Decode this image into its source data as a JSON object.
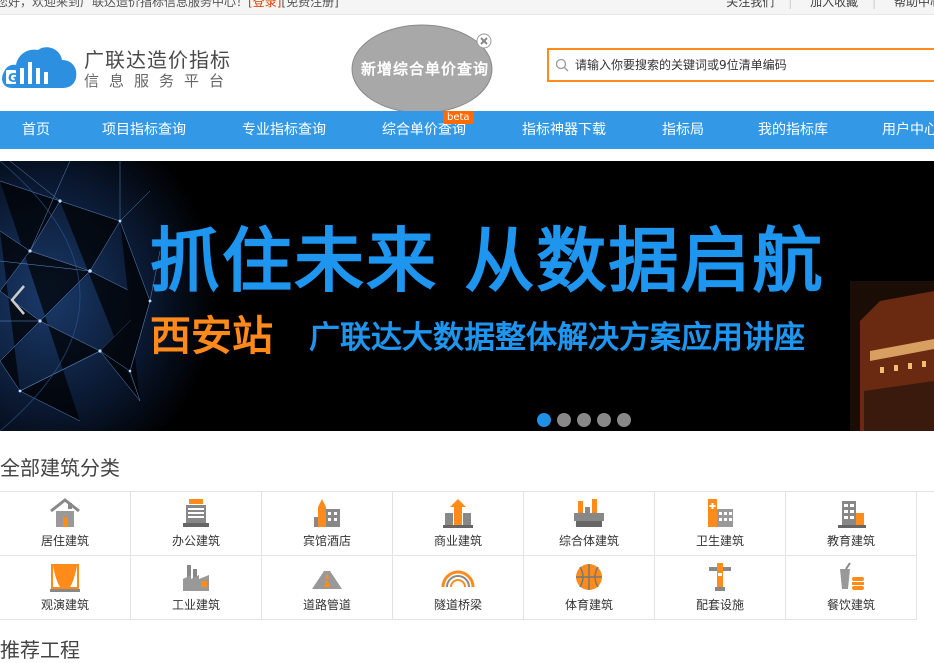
{
  "topbar": {
    "welcome": "您好，欢迎来到广联达造价指标信息服务中心！",
    "login": "[登录]",
    "register": "[免费注册]",
    "links": [
      "关注我们",
      "加入收藏",
      "帮助中心"
    ]
  },
  "header": {
    "brand_title": "广联达造价指标",
    "brand_sub": "信息服务平台",
    "bubble_text": "新增综合单价查询"
  },
  "search": {
    "placeholder": "请输入你要搜索的关键词或9位清单编码"
  },
  "nav": {
    "items": [
      "首页",
      "项目指标查询",
      "专业指标查询",
      "综合单价查询",
      "指标神器下载",
      "指标局",
      "我的指标库",
      "用户中心"
    ],
    "beta": "beta"
  },
  "banner": {
    "title": "抓住未来 从数据启航",
    "city": "西安站",
    "subtitle": "广联达大数据整体解决方案应用讲座",
    "slide_count": 5,
    "active_slide": 1
  },
  "category": {
    "title": "全部建筑分类",
    "items": [
      {
        "label": "居住建筑",
        "icon": "house-icon"
      },
      {
        "label": "办公建筑",
        "icon": "office-building-icon"
      },
      {
        "label": "宾馆酒店",
        "icon": "hotel-icon"
      },
      {
        "label": "商业建筑",
        "icon": "commercial-building-icon"
      },
      {
        "label": "综合体建筑",
        "icon": "complex-building-icon"
      },
      {
        "label": "卫生建筑",
        "icon": "hospital-icon"
      },
      {
        "label": "教育建筑",
        "icon": "school-icon"
      },
      {
        "label": "观演建筑",
        "icon": "theater-icon"
      },
      {
        "label": "工业建筑",
        "icon": "factory-icon"
      },
      {
        "label": "道路管道",
        "icon": "road-icon"
      },
      {
        "label": "隧道桥梁",
        "icon": "bridge-icon"
      },
      {
        "label": "体育建筑",
        "icon": "basketball-icon"
      },
      {
        "label": "配套设施",
        "icon": "facility-icon"
      },
      {
        "label": "餐饮建筑",
        "icon": "restaurant-icon"
      }
    ]
  },
  "recommend": {
    "title": "推荐工程"
  },
  "colors": {
    "nav_blue": "#3399e6",
    "accent_orange": "#ff8c1a",
    "banner_blue": "#1e96f0"
  }
}
